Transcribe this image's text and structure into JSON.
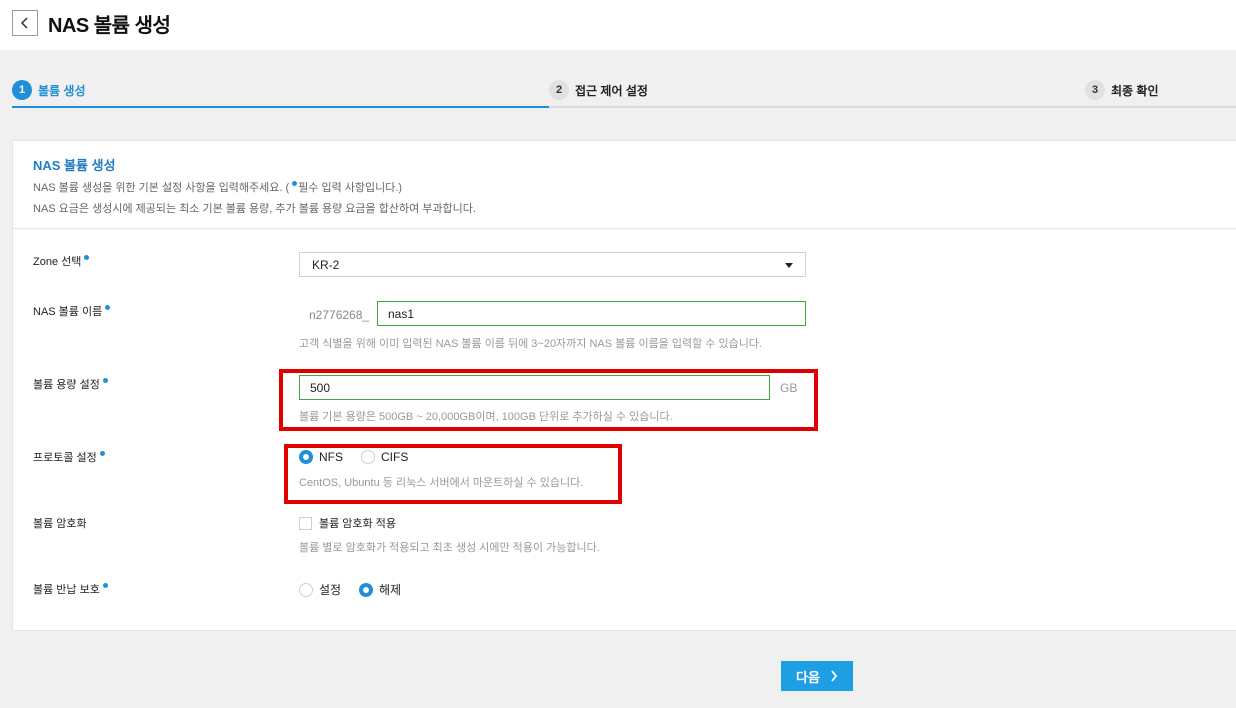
{
  "header": {
    "title": "NAS 볼륨 생성"
  },
  "stepper": {
    "steps": [
      {
        "num": "1",
        "label": "볼륨 생성"
      },
      {
        "num": "2",
        "label": "접근 제어 설정"
      },
      {
        "num": "3",
        "label": "최종 확인"
      }
    ]
  },
  "panel": {
    "title": "NAS 볼륨 생성",
    "desc1_pre": "NAS 볼륨 생성을 위한 기본 설정 사항을 입력해주세요. (",
    "desc1_post": "필수 입력 사항입니다.)",
    "desc2": "NAS 요금은 생성시에 제공되는 최소 기본 볼륨 용량, 추가 볼륨 용량 요금을 합산하여 부과합니다."
  },
  "form": {
    "zone": {
      "label": "Zone 선택",
      "value": "KR-2"
    },
    "name": {
      "label": "NAS 볼륨 이름",
      "prefix": "n2776268_",
      "value": "nas1",
      "hint": "고객 식별을 위해 이미 입력된 NAS 볼륨 이름 뒤에 3~20자까지 NAS 볼륨 이름을 입력할 수 있습니다."
    },
    "size": {
      "label": "볼륨 용량 설정",
      "value": "500",
      "unit": "GB",
      "hint": "볼륨 기본 용량은 500GB ~ 20,000GB이며, 100GB 단위로 추가하실 수 있습니다."
    },
    "protocol": {
      "label": "프로토콜 설정",
      "options": [
        "NFS",
        "CIFS"
      ],
      "selected": "NFS",
      "hint": "CentOS, Ubuntu 등 리눅스 서버에서 마운트하실 수 있습니다."
    },
    "encryption": {
      "label": "볼륨 암호화",
      "checkbox_label": "볼륨 암호화 적용",
      "checked": false,
      "hint": "볼륨 별로 암호화가 적용되고 최초 생성 시에만 적용이 가능합니다."
    },
    "return_protect": {
      "label": "볼륨 반납 보호",
      "options": [
        "설정",
        "해제"
      ],
      "selected": "해제"
    }
  },
  "footer": {
    "next_label": "다음"
  },
  "colors": {
    "accent": "#1f8fd8",
    "highlight": "#e10000",
    "input_border": "#3daa3d"
  }
}
